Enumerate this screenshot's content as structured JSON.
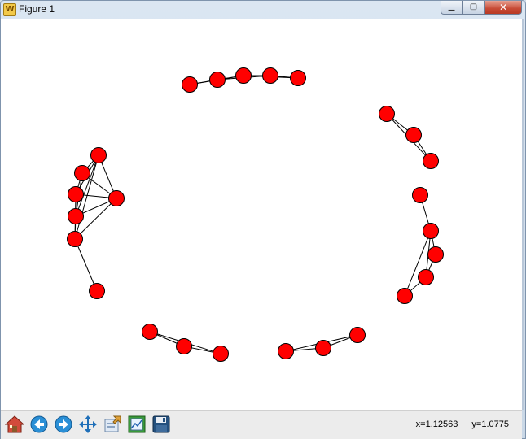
{
  "window": {
    "title": "Figure 1",
    "controls": [
      "minimize",
      "maximize",
      "close"
    ]
  },
  "toolbar": {
    "buttons": [
      {
        "name": "home-button",
        "icon": "home-icon"
      },
      {
        "name": "back-button",
        "icon": "arrow-left-icon"
      },
      {
        "name": "forward-button",
        "icon": "arrow-right-icon"
      },
      {
        "name": "pan-button",
        "icon": "move-icon"
      },
      {
        "name": "zoom-button",
        "icon": "zoom-rect-icon"
      },
      {
        "name": "subplots-button",
        "icon": "subplots-icon"
      },
      {
        "name": "save-button",
        "icon": "save-icon"
      }
    ]
  },
  "status": {
    "x_readout": "x=1.12563",
    "y_readout": "y=1.0775"
  },
  "colors": {
    "node_fill": "#ff0000",
    "node_stroke": "#000000",
    "edge": "#000000",
    "canvas_bg": "#ffffff"
  }
}
